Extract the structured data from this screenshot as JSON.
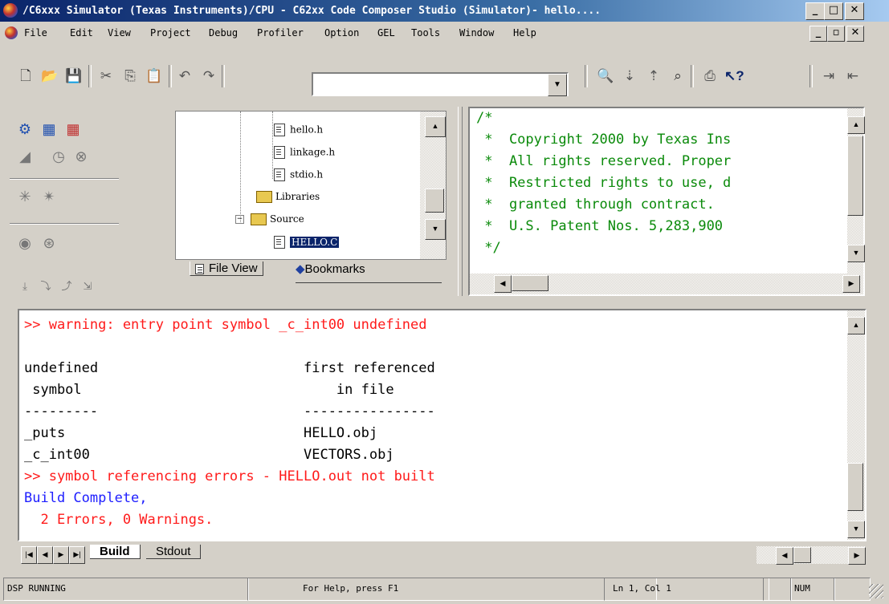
{
  "window": {
    "title": "/C6xxx Simulator (Texas Instruments)/CPU - C62xx Code Composer Studio (Simulator)- hello...."
  },
  "menu": [
    "File",
    "Edit",
    "View",
    "Project",
    "Debug",
    "Profiler",
    "Option",
    "GEL",
    "Tools",
    "Window",
    "Help"
  ],
  "toolbar": {
    "combo_value": "",
    "icons": [
      "new-file-icon",
      "open-folder-icon",
      "save-icon",
      "cut-icon",
      "copy-icon",
      "paste-icon",
      "undo-icon",
      "redo-icon",
      "find-icon",
      "find-next-icon",
      "find-prev-icon",
      "binoculars-icon",
      "print-icon",
      "help-pointer-icon",
      "indent-icon",
      "outdent-icon"
    ]
  },
  "project_tree": {
    "items": [
      {
        "label": "hello.h",
        "type": "file"
      },
      {
        "label": "linkage.h",
        "type": "file"
      },
      {
        "label": "stdio.h",
        "type": "file"
      },
      {
        "label": "Libraries",
        "type": "folder"
      },
      {
        "label": "Source",
        "type": "folder"
      },
      {
        "label": "HELLO.C",
        "type": "file",
        "selected": true
      }
    ],
    "tabs": [
      "File View",
      "Bookmarks"
    ]
  },
  "editor": {
    "lines": [
      "/*",
      " *  Copyright 2000 by Texas Ins",
      " *  All rights reserved. Proper",
      " *  Restricted rights to use, d",
      " *  granted through contract.",
      " *  U.S. Patent Nos. 5,283,900",
      " */"
    ]
  },
  "output": {
    "lines": [
      {
        "text": ">> warning: entry point symbol _c_int00 undefined",
        "color": "red"
      },
      {
        "text": "",
        "color": "black"
      },
      {
        "text": "undefined                         first referenced",
        "color": "black"
      },
      {
        "text": " symbol                               in file",
        "color": "black"
      },
      {
        "text": "---------                         ----------------",
        "color": "black"
      },
      {
        "text": "_puts                             HELLO.obj",
        "color": "black"
      },
      {
        "text": "_c_int00                          VECTORS.obj",
        "color": "black"
      },
      {
        "text": ">> symbol referencing errors - HELLO.out not built",
        "color": "red"
      },
      {
        "text": "Build Complete,",
        "color": "blue"
      },
      {
        "text": "  2 Errors, 0 Warnings.",
        "color": "red"
      }
    ],
    "tabs": [
      "Build",
      "Stdout"
    ]
  },
  "status": {
    "cpu_state": "DSP RUNNING",
    "help": "For Help, press F1",
    "position": "Ln 1, Col 1",
    "num": "NUM"
  }
}
